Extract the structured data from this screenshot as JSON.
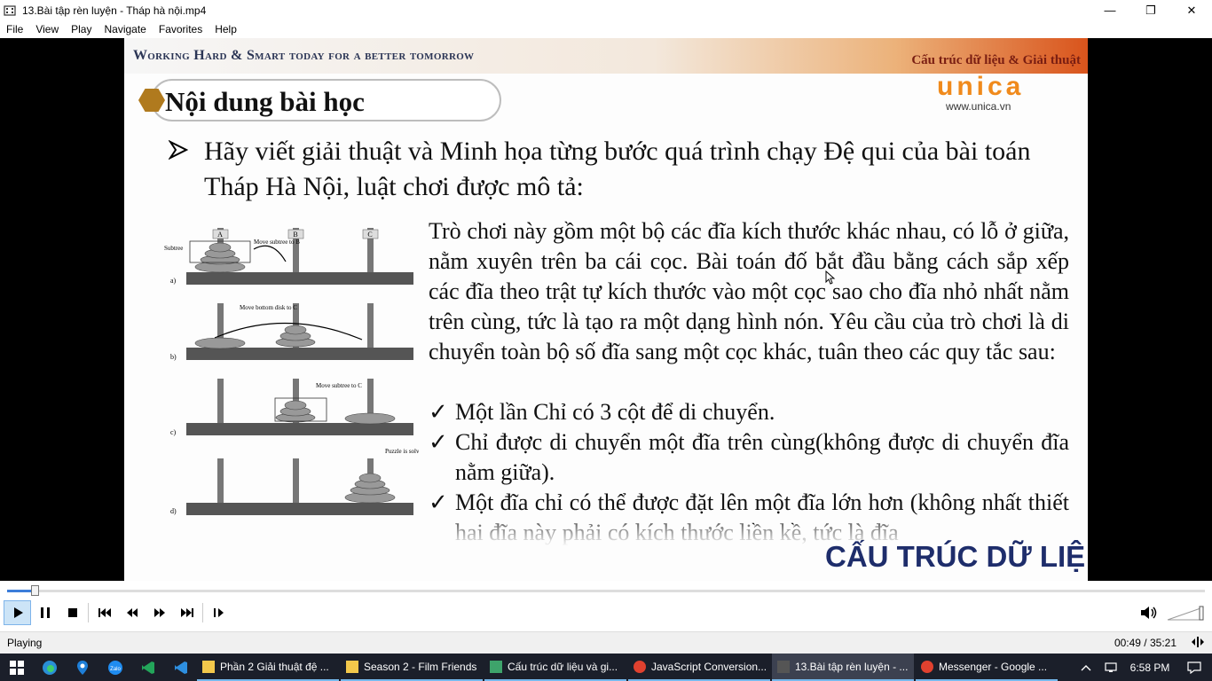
{
  "window": {
    "title": "13.Bài tập rèn luyện - Tháp hà nội.mp4",
    "minimize_glyph": "—",
    "restore_glyph": "❐",
    "close_glyph": "✕"
  },
  "menu": [
    "File",
    "View",
    "Play",
    "Navigate",
    "Favorites",
    "Help"
  ],
  "slide": {
    "motto": "Working Hard & Smart today for a better tomorrow",
    "course": "Cấu trúc dữ liệu & Giải thuật",
    "logo": "unica",
    "logo_url": "www.unica.vn",
    "heading": "Nội dung bài học",
    "bullet": "Hãy viết giải thuật và Minh họa từng bước quá trình chạy Đệ qui của bài toán Tháp Hà Nội, luật chơi được mô tả:",
    "paragraph": "Trò chơi này gồm một bộ các đĩa kích thước khác nhau, có lỗ ở giữa, nằm xuyên trên ba cái cọc. Bài toán đố bắt đầu bằng cách sắp xếp các đĩa theo trật tự kích thước vào một cọc sao cho đĩa nhỏ nhất nằm trên cùng, tức là tạo ra một dạng hình nón. Yêu cầu của trò chơi là di chuyển toàn bộ số đĩa sang một cọc khác, tuân theo các quy tắc sau:",
    "rules": [
      "Một lần Chỉ có 3 cột để di chuyển.",
      "Chỉ được di chuyển một đĩa trên cùng(không được di chuyển đĩa nằm giữa).",
      "Một đĩa chỉ có thể được đặt lên một đĩa lớn hơn (không nhất thiết hai đĩa này phải có kích thước liền kề, tức là đĩa"
    ],
    "footer_title": "CẤU TRÚC DỮ LIỆ",
    "diagram": {
      "pegs": [
        "A",
        "B",
        "C"
      ],
      "rows": [
        {
          "label": "a)",
          "note": "Move subtree to B",
          "tag": "Subtree"
        },
        {
          "label": "b)",
          "note": "Move bottom disk to C"
        },
        {
          "label": "c)",
          "note": "Move subtree to C"
        },
        {
          "label": "d)",
          "note": "Puzzle is solved!"
        }
      ]
    }
  },
  "player": {
    "progress": 0.0231,
    "status": "Playing",
    "time": "00:49 / 35:21"
  },
  "taskbar": {
    "tasks": [
      {
        "label": "Phần 2 Giải thuật đệ ...",
        "color": "#f3c84b"
      },
      {
        "label": "Season 2 - Film Friends",
        "color": "#f3c84b"
      },
      {
        "label": "Cấu trúc dữ liệu và gi...",
        "color": "#3ea36b"
      },
      {
        "label": "JavaScript Conversion...",
        "color": "#e0412f"
      },
      {
        "label": "13.Bài tập rèn luyện - ...",
        "color": "#555555"
      },
      {
        "label": "Messenger - Google ...",
        "color": "#e0412f"
      }
    ],
    "clock": "6:58 PM"
  }
}
